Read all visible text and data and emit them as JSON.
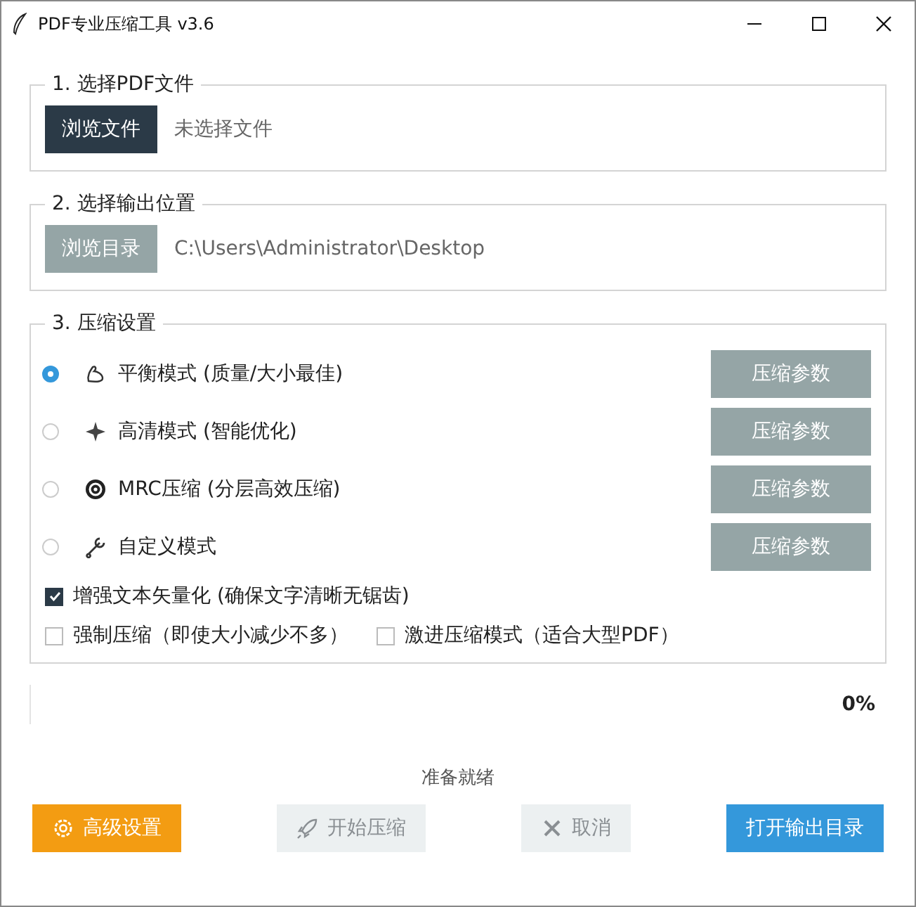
{
  "window": {
    "title": "PDF专业压缩工具 v3.6"
  },
  "file_section": {
    "title": "1. 选择PDF文件",
    "button": {
      "label": "浏览文件",
      "kind": "dark"
    },
    "value": "未选择文件"
  },
  "output_section": {
    "title": "2. 选择输出位置",
    "button": {
      "label": "浏览目录",
      "kind": "secondary"
    },
    "value": "C:\\Users\\Administrator\\Desktop"
  },
  "compression": {
    "title": "3. 压缩设置",
    "modes": [
      {
        "label": "平衡模式 (质量/大小最佳)",
        "selected": true,
        "button": "压缩参数"
      },
      {
        "label": "高清模式 (智能优化)",
        "selected": false,
        "button": "压缩参数"
      },
      {
        "label": "MRC压缩 (分层高效压缩)",
        "selected": false,
        "button": "压缩参数"
      },
      {
        "label": "自定义模式",
        "selected": false,
        "button": "压缩参数"
      }
    ],
    "options": [
      {
        "label": "增强文本矢量化 (确保文字清晰无锯齿)",
        "checked": true
      },
      {
        "label": "强制压缩（即使大小减少不多）",
        "checked": false
      },
      {
        "label": "激进压缩模式（适合大型PDF）",
        "checked": false
      }
    ]
  },
  "progress": {
    "level": 0,
    "reading": "0%"
  },
  "status": "准备就绪",
  "buttons": [
    {
      "label": "高级设置",
      "kind": "warning",
      "disabled": false
    },
    {
      "label": "开始压缩",
      "kind": "start",
      "disabled": true
    },
    {
      "label": "取消",
      "kind": "cancel",
      "disabled": true
    },
    {
      "label": "打开输出目录",
      "kind": "info",
      "disabled": false
    }
  ]
}
